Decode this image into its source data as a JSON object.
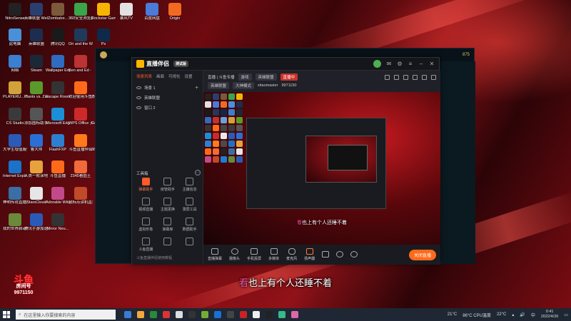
{
  "desktop": {
    "icons": [
      {
        "label": "NitroSense",
        "color": "#222"
      },
      {
        "label": "英雄联盟 WeGame版",
        "color": "#2a3f70"
      },
      {
        "label": "Zombator...",
        "color": "#7a5a3a"
      },
      {
        "label": "360安全浏览器",
        "color": "#3aa54a"
      },
      {
        "label": "Rockstar Games...",
        "color": "#f5b400"
      },
      {
        "label": "暴风TV",
        "color": "#e2e2e2"
      },
      {
        "label": "百度网盘",
        "color": "#4a7bd8"
      },
      {
        "label": "Origin",
        "color": "#f26a21"
      },
      {
        "label": "此电脑",
        "color": "#4a90d9"
      },
      {
        "label": "英雄联盟",
        "color": "#1d2d50"
      },
      {
        "label": "腾讯QQ",
        "color": "#1a1a1a"
      },
      {
        "label": "Ori and the Will of th...",
        "color": "#1f3a5a"
      },
      {
        "label": "Ps",
        "color": "#0d2a4a"
      },
      {
        "label": "网络",
        "color": "#3b7fd0"
      },
      {
        "label": "Steam",
        "color": "#1b2838"
      },
      {
        "label": "Wallpaper Engine:...",
        "color": "#2d6cc0"
      },
      {
        "label": "Ben and Ed - Blood P...",
        "color": "#b33"
      },
      {
        "label": "回收站",
        "color": "#6aa0d8"
      },
      {
        "label": "PLAYERU... BATTLEG...",
        "color": "#d1a23a"
      },
      {
        "label": "Plants vs. Zombies G...",
        "color": "#5a9a2a"
      },
      {
        "label": "Escape Room - T...",
        "color": "#333"
      },
      {
        "label": "欢迎使用斗鱼直播助手",
        "color": "#ff6a1a"
      },
      {
        "label": "本区域全部是我桌面的应用程序",
        "color": "#444"
      },
      {
        "label": "CS Studio",
        "color": "#3a3a3a"
      },
      {
        "label": "添加图标助手(试用)",
        "color": "#555"
      },
      {
        "label": "Microsoft Edge",
        "color": "#1b8fd6"
      },
      {
        "label": "WPS Office 天天 Emlio",
        "color": "#cc2a2a"
      },
      {
        "label": "Google Chrome",
        "color": "#e8e8e8"
      },
      {
        "label": "大学生增值服务.docx",
        "color": "#2b5bb8"
      },
      {
        "label": "鲁大师",
        "color": "#2a6fd6"
      },
      {
        "label": "FlashFXP",
        "color": "#2d7fd0"
      },
      {
        "label": "斗鱼直播伴侣",
        "color": "#ff7a1a"
      },
      {
        "label": "360小程序加速",
        "color": "#4a4a4a"
      },
      {
        "label": "Internet Explorer",
        "color": "#1a73c9"
      },
      {
        "label": "人类一败涂地 Human Fa...",
        "color": "#e6a23c"
      },
      {
        "label": "斗鱼直播",
        "color": "#ff6a1a"
      },
      {
        "label": "2345看图王",
        "color": "#f06a3a"
      },
      {
        "label": "WeGame",
        "color": "#222"
      },
      {
        "label": "神明传说直播版",
        "color": "#3a6ea5"
      },
      {
        "label": "StarsCloud",
        "color": "#e6e6e6"
      },
      {
        "label": "Adorable Witch",
        "color": "#c24a8a"
      },
      {
        "label": "鼠标点读机直播",
        "color": "#c04a2a"
      },
      {
        "label": "QQ游戏",
        "color": "#1a7fd8"
      },
      {
        "label": "我的世界启动器",
        "color": "#6a8a3a"
      },
      {
        "label": "腾讯手游加速器",
        "color": "#2a5ab8"
      },
      {
        "label": "Mirror Neu...",
        "color": "#333"
      }
    ]
  },
  "bg_window": {
    "number": "875"
  },
  "app": {
    "title": "直播伴侣",
    "version": "测试版",
    "sidebar": {
      "tabs": [
        "场景列表",
        "画面",
        "可视化",
        "设置"
      ],
      "sources": [
        "场景 1",
        "英雄联盟",
        "窗口 2"
      ],
      "tools_title": "工具箱",
      "tools": [
        "弹幕助手",
        "房管助手",
        "主播信息",
        "视频直播",
        "主题更换",
        "录屏工具",
        "虚拟形象",
        "弹幕库",
        "数据助手",
        "斗鱼直播",
        "",
        ""
      ],
      "footer": "斗鱼直播伴侣使用教程"
    },
    "topbar": {
      "title": "直播 | 斗鱼专播",
      "tag": "游戏",
      "room_label": "英雄联盟",
      "live_chip": "直播中",
      "row2": [
        "英雄联盟",
        "大神模式",
        "xitaomaster",
        "9971150"
      ]
    },
    "preview_subtitle_pre": "看",
    "preview_subtitle": "也上有个人还睡不着",
    "controls": [
      "直播弹幕",
      "摄像头",
      "手机投屏",
      "多媒体",
      "麦克风",
      "扬声器"
    ],
    "start_button": "关闭直播"
  },
  "overlay": {
    "subtitle_pre": "看",
    "subtitle": "也上有个人还睡不着",
    "watermark_top": "斗鱼",
    "watermark_mid": "房间号",
    "watermark_num": "9971150"
  },
  "taskbar": {
    "search_placeholder": "在这里输入你要搜索的内容",
    "weather": "21°C",
    "cpu": "86°C CPU温度",
    "weather2": "22°C",
    "lang": "中",
    "time": "0:41",
    "date": "2022/4/26",
    "app_colors": [
      "#3a7bd5",
      "#f2a93b",
      "#2a8a3a",
      "#d33",
      "#ddd",
      "#333",
      "#7a3",
      "#1a6fd6",
      "#444",
      "#c22",
      "#eee",
      "#222",
      "#3b8",
      "#d6a"
    ]
  }
}
